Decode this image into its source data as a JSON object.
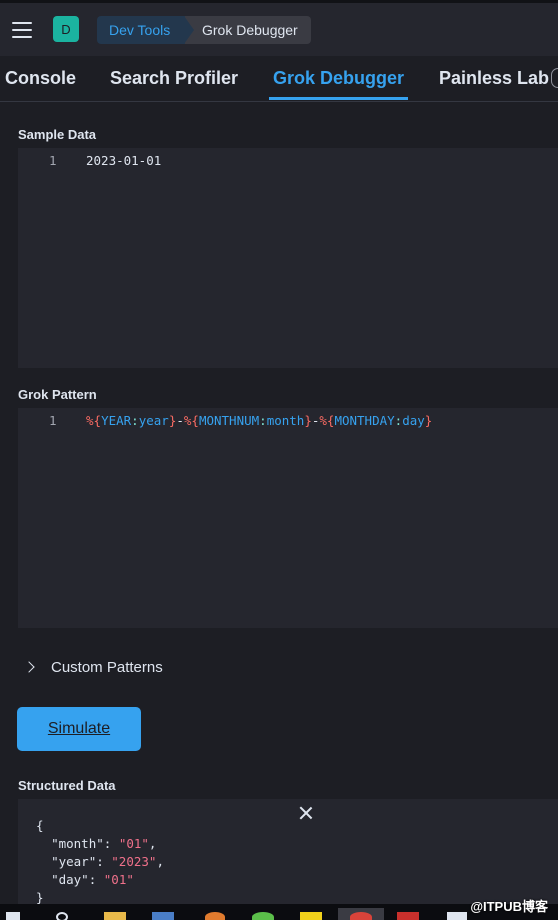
{
  "header": {
    "space_initial": "D",
    "breadcrumbs": [
      "Dev Tools",
      "Grok Debugger"
    ]
  },
  "tabs": [
    {
      "label": "Console",
      "active": false
    },
    {
      "label": "Search Profiler",
      "active": false
    },
    {
      "label": "Grok Debugger",
      "active": true
    },
    {
      "label": "Painless Lab",
      "active": false
    }
  ],
  "sample_data": {
    "label": "Sample Data",
    "line_number": "1",
    "value": "2023-01-01"
  },
  "grok_pattern": {
    "label": "Grok Pattern",
    "line_number": "1",
    "tokens": {
      "year_pattern": "YEAR",
      "year_field": "year",
      "month_pattern": "MONTHNUM",
      "month_field": "month",
      "day_pattern": "MONTHDAY",
      "day_field": "day"
    }
  },
  "custom_patterns": {
    "label": "Custom Patterns"
  },
  "simulate": {
    "label": "Simulate"
  },
  "structured_data": {
    "label": "Structured Data",
    "open_brace": "{",
    "close_brace": "}",
    "fields": [
      {
        "key": "\"month\"",
        "value": "\"01\""
      },
      {
        "key": "\"year\"",
        "value": "\"2023\""
      },
      {
        "key": "\"day\"",
        "value": "\"01\""
      }
    ]
  },
  "watermark": "@ITPUB博客",
  "colors": {
    "accent": "#36a2ef",
    "background": "#1d1e24",
    "editor": "#25262e",
    "string": "#f0718b",
    "brace": "#f86b63"
  }
}
